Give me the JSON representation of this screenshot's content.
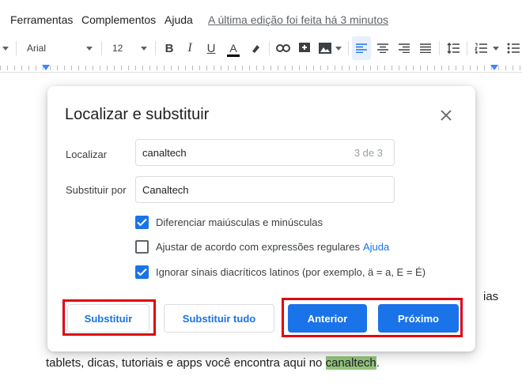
{
  "menu": {
    "items": [
      "Ferramentas",
      "Complementos",
      "Ajuda"
    ],
    "last_edit": "A última edição foi feita há 3 minutos"
  },
  "toolbar": {
    "font": "Arial",
    "font_size": "12",
    "bold": "B",
    "italic": "I",
    "underline": "U",
    "text_color": "A"
  },
  "document": {
    "behind_right": "ias",
    "line_bottom_prefix": "tablets, dicas, tutoriais e apps você encontra aqui no ",
    "line_bottom_highlight": "canaltech",
    "line_bottom_suffix": "."
  },
  "dialog": {
    "title": "Localizar e substituir",
    "find_label": "Localizar",
    "find_value": "canaltech",
    "find_count": "3 de 3",
    "replace_label": "Substituir por",
    "replace_value": "Canaltech",
    "options": [
      {
        "label": "Diferenciar maiúsculas e minúsculas",
        "checked": true
      },
      {
        "label": "Ajustar de acordo com expressões regulares",
        "checked": false,
        "link": "Ajuda"
      },
      {
        "label": "Ignorar sinais diacríticos latinos (por exemplo, ä = a, E = É)",
        "checked": true
      }
    ],
    "buttons": {
      "replace": "Substituir",
      "replace_all": "Substituir tudo",
      "previous": "Anterior",
      "next": "Próximo"
    }
  },
  "colors": {
    "accent": "#1a73e8",
    "annotation_red": "#e00012",
    "highlight": "#93c47d"
  }
}
